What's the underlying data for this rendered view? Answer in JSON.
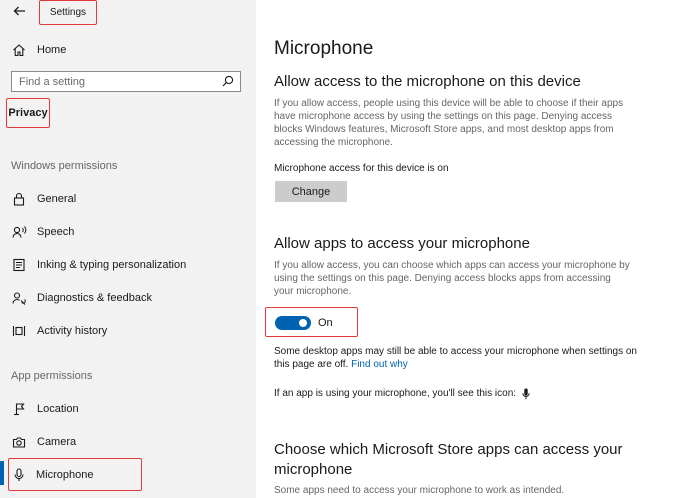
{
  "window": {
    "title": "Settings"
  },
  "sidebar": {
    "home_label": "Home",
    "search_placeholder": "Find a setting",
    "category": "Privacy",
    "windows_permissions_label": "Windows permissions",
    "windows_items": [
      {
        "label": "General",
        "icon": "lock-icon"
      },
      {
        "label": "Speech",
        "icon": "speech-icon"
      },
      {
        "label": "Inking & typing personalization",
        "icon": "inking-icon"
      },
      {
        "label": "Diagnostics & feedback",
        "icon": "diagnostics-icon"
      },
      {
        "label": "Activity history",
        "icon": "activity-history-icon"
      }
    ],
    "app_permissions_label": "App permissions",
    "app_items": [
      {
        "label": "Location",
        "icon": "location-icon"
      },
      {
        "label": "Camera",
        "icon": "camera-icon"
      },
      {
        "label": "Microphone",
        "icon": "microphone-icon",
        "selected": true
      }
    ]
  },
  "main": {
    "title": "Microphone",
    "device_section": {
      "heading": "Allow access to the microphone on this device",
      "description": "If you allow access, people using this device will be able to choose if their apps have microphone access by using the settings on this page. Denying access blocks Windows features, Microsoft Store apps, and most desktop apps from accessing the microphone.",
      "status": "Microphone access for this device is on",
      "change_label": "Change"
    },
    "apps_section": {
      "heading": "Allow apps to access your microphone",
      "description": "If you allow access, you can choose which apps can access your microphone by using the settings on this page. Denying access blocks apps from accessing your microphone.",
      "toggle_state": "On",
      "desktop_note": "Some desktop apps may still be able to access your microphone when settings on this page are off.",
      "find_out_why": "Find out why",
      "icon_note": "If an app is using your microphone, you'll see this icon:"
    },
    "store_section": {
      "heading": "Choose which Microsoft Store apps can access your microphone",
      "description": "Some apps need to access your microphone to work as intended."
    }
  },
  "colors": {
    "accent": "#0063b1",
    "highlight": "#e0393e",
    "sidebar_bg": "#f2f2f2"
  }
}
